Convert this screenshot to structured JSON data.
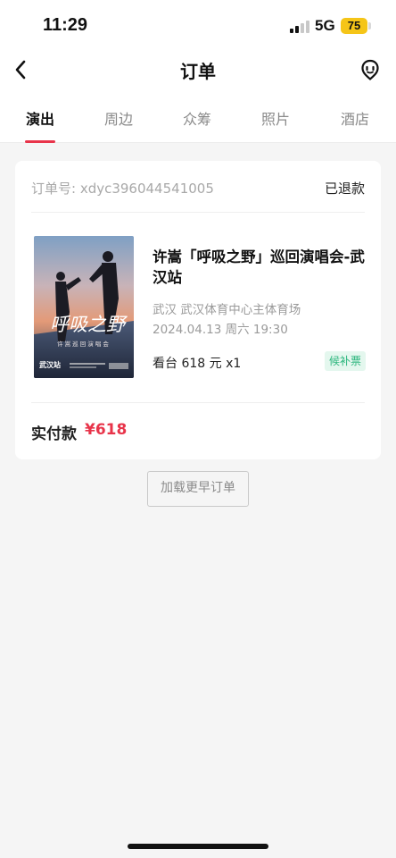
{
  "status_bar": {
    "time": "11:29",
    "network": "5G",
    "battery": "75"
  },
  "navbar": {
    "title": "订单",
    "back_icon": "chevron-left-icon",
    "service_icon": "customer-service-icon"
  },
  "tabs": [
    {
      "label": "演出",
      "active": true
    },
    {
      "label": "周边",
      "active": false
    },
    {
      "label": "众筹",
      "active": false
    },
    {
      "label": "照片",
      "active": false
    },
    {
      "label": "酒店",
      "active": false
    }
  ],
  "order": {
    "order_number": "订单号: xdyc396044541005",
    "status": "已退款",
    "show_title": "许嵩「呼吸之野」巡回演唱会-武汉站",
    "venue": "武汉 武汉体育中心主体育场",
    "datetime": "2024.04.13 周六 19:30",
    "ticket": "看台 618 元 x1",
    "badge": "候补票",
    "paid_label": "实付款",
    "paid_amount": "¥618",
    "poster": {
      "title_art": "呼吸之野",
      "subtitle": "许 嵩 巡 回 演 唱 会",
      "city": "武汉站"
    }
  },
  "load_more_label": "加载更早订单",
  "colors": {
    "accent": "#e8344a",
    "badge_green": "#2cb67d",
    "battery_yellow": "#f5c518"
  }
}
